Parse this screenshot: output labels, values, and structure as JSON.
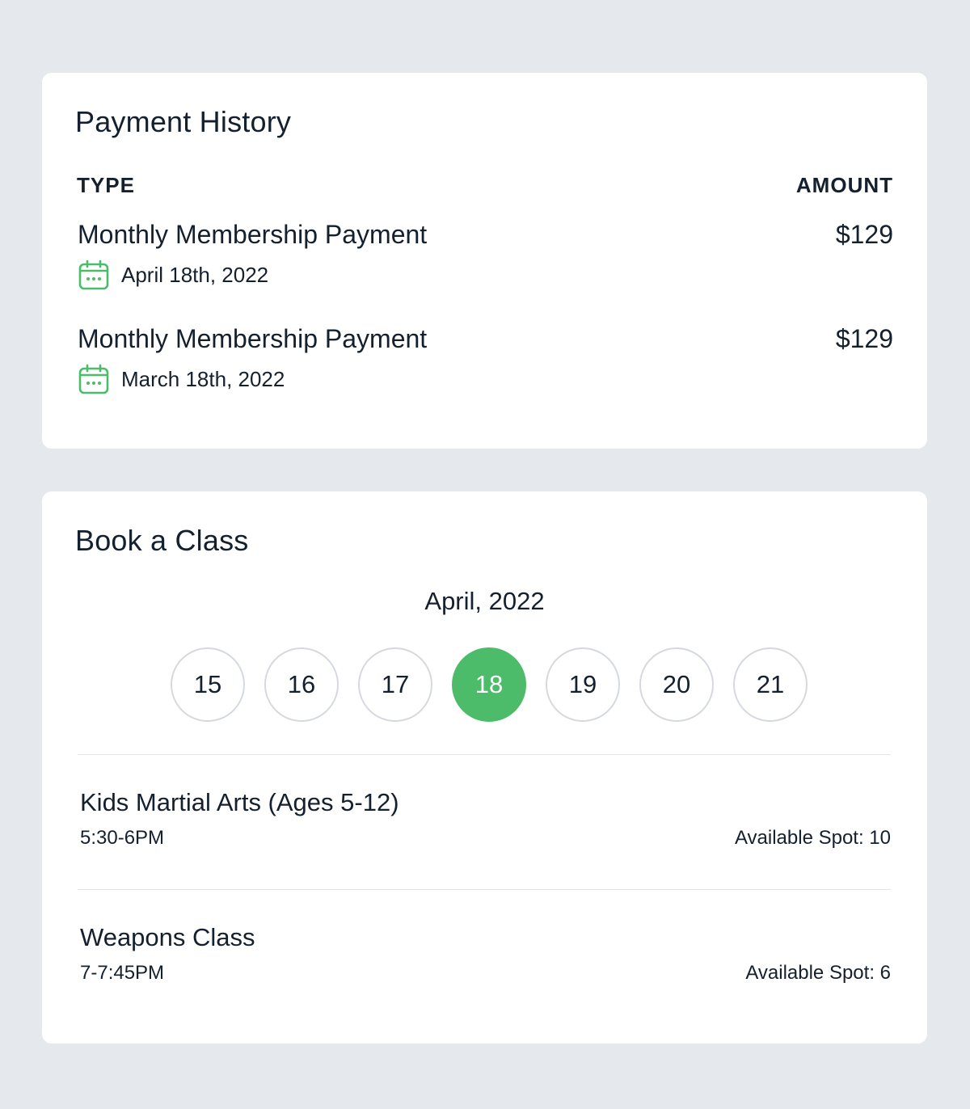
{
  "payment_history": {
    "title": "Payment History",
    "columns": {
      "type": "TYPE",
      "amount": "AMOUNT"
    },
    "rows": [
      {
        "type": "Monthly Membership Payment",
        "date": "April 18th, 2022",
        "amount": "$129",
        "icon": "calendar-icon"
      },
      {
        "type": "Monthly Membership Payment",
        "date": "March 18th, 2022",
        "amount": "$129",
        "icon": "calendar-icon"
      }
    ]
  },
  "book_class": {
    "title": "Book a Class",
    "month": "April, 2022",
    "days": [
      "15",
      "16",
      "17",
      "18",
      "19",
      "20",
      "21"
    ],
    "selected_day": "18",
    "classes": [
      {
        "name": "Kids Martial Arts (Ages 5-12)",
        "time": "5:30-6PM",
        "spots": "Available Spot: 10"
      },
      {
        "name": "Weapons Class",
        "time": "7-7:45PM",
        "spots": "Available Spot: 6"
      }
    ]
  },
  "colors": {
    "accent": "#4cbb6a",
    "background": "#e5e9ee",
    "card": "#ffffff",
    "text": "#15202e"
  }
}
